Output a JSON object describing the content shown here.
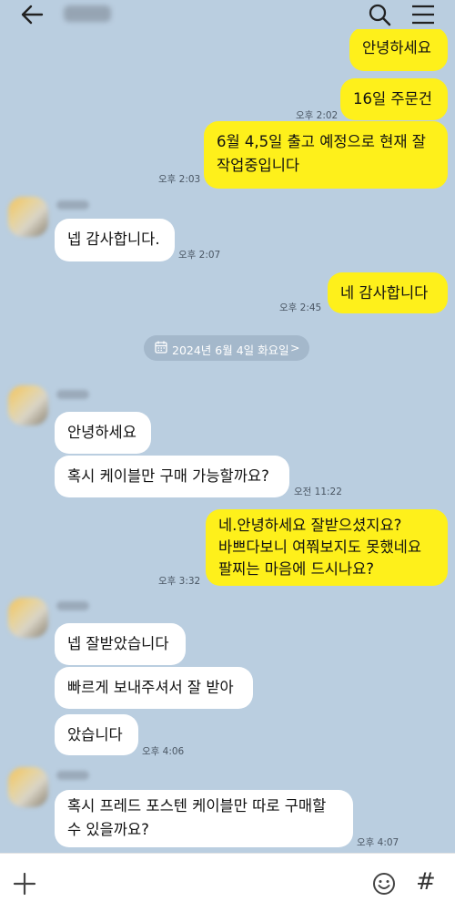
{
  "header": {
    "title": "",
    "back": "back-arrow-icon",
    "search": "search-icon",
    "menu": "hamburger-menu-icon"
  },
  "messages": [
    {
      "side": "me",
      "text": "안녕하세요",
      "time": ""
    },
    {
      "side": "me",
      "text": "16일 주문건",
      "time": "오후 2:02"
    },
    {
      "side": "me",
      "lines": [
        "6월 4,5일 출고 예정으로 현재 잘",
        "작업중입니다"
      ],
      "time": "오후 2:03"
    },
    {
      "side": "you",
      "text": "넵 감사합니다.",
      "time": "오후 2:07"
    },
    {
      "side": "me",
      "text": "네 감사합니다",
      "time": "오후 2:45"
    },
    {
      "side": "you",
      "text": "안녕하세요",
      "time": ""
    },
    {
      "side": "you",
      "text": "혹시 케이블만 구매 가능할까요?",
      "time": "오전 11:22"
    },
    {
      "side": "me",
      "lines": [
        "네.안녕하세요 잘받으셨지요?",
        "바쁘다보니 여쭤보지도 못했네요",
        "팔찌는 마음에 드시나요?"
      ],
      "time": "오후 3:32"
    },
    {
      "side": "you",
      "text": "넵 잘받았습니다",
      "time": ""
    },
    {
      "side": "you",
      "text": "빠르게 보내주셔서 잘 받아",
      "time": ""
    },
    {
      "side": "you",
      "text": "았습니다",
      "time": "오후 4:06"
    },
    {
      "side": "you",
      "lines": [
        "혹시 프레드 포스텐 케이블만 따로 구매할",
        "수 있을까요?"
      ],
      "time": "오후 4:07"
    }
  ],
  "date_divider": {
    "text": "2024년 6월 4일 화요일",
    "chevron": ">"
  },
  "input_bar": {
    "plus": "plus-icon",
    "emoji": "emoji-icon",
    "hash": "#"
  },
  "colors": {
    "background": "#bacee0",
    "my_bubble": "#fef01b",
    "their_bubble": "#ffffff"
  }
}
